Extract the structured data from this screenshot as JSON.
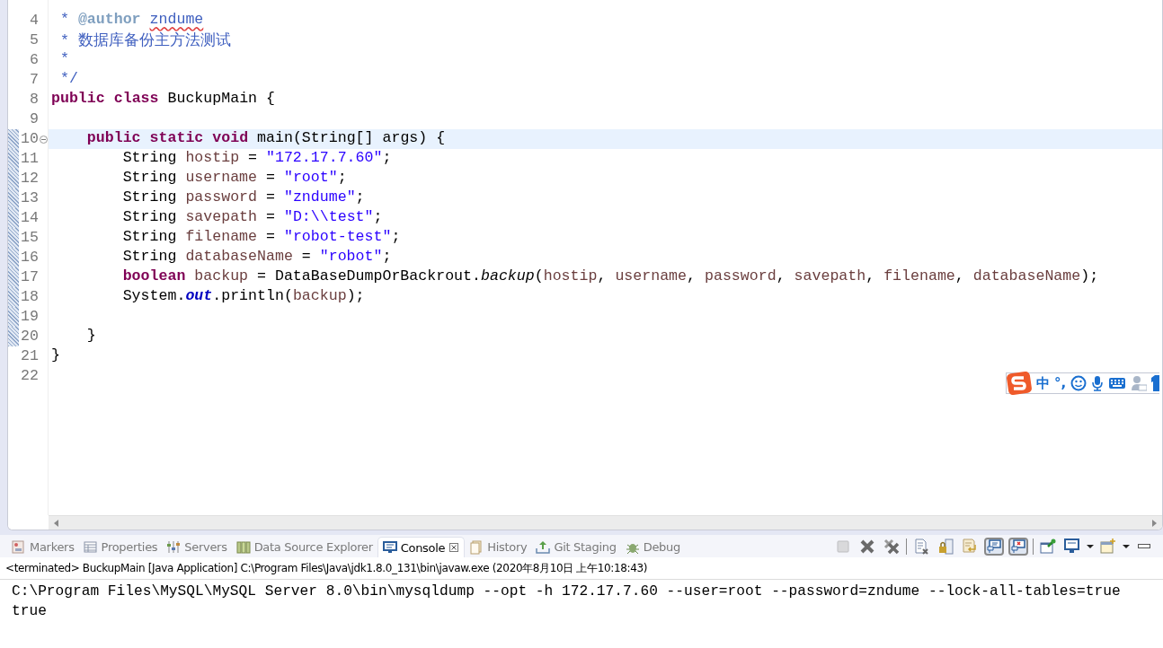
{
  "editor": {
    "lines": [
      {
        "number": "4",
        "current": false,
        "changed": false,
        "tokens": [
          {
            "kind": "comment",
            "text": " * "
          },
          {
            "kind": "doctag",
            "text": "@author "
          },
          {
            "kind": "misspelled",
            "text": "zndume"
          }
        ]
      },
      {
        "number": "5",
        "current": false,
        "changed": false,
        "tokens": [
          {
            "kind": "comment",
            "text": " * 数据库备份主方法测试"
          }
        ]
      },
      {
        "number": "6",
        "current": false,
        "changed": false,
        "tokens": [
          {
            "kind": "comment",
            "text": " *"
          }
        ]
      },
      {
        "number": "7",
        "current": false,
        "changed": false,
        "tokens": [
          {
            "kind": "comment",
            "text": " */"
          }
        ]
      },
      {
        "number": "8",
        "current": false,
        "changed": false,
        "tokens": [
          {
            "kind": "keyword",
            "text": "public "
          },
          {
            "kind": "keyword",
            "text": "class "
          },
          {
            "kind": "plain",
            "text": "BuckupMain {"
          }
        ]
      },
      {
        "number": "9",
        "current": false,
        "changed": false
      },
      {
        "number": "10",
        "current": true,
        "changed": true,
        "fold": {
          "expanded": true
        },
        "tokens": [
          {
            "kind": "keyword",
            "text": "    public "
          },
          {
            "kind": "keyword",
            "text": "static "
          },
          {
            "kind": "keyword",
            "text": "void "
          },
          {
            "kind": "plain",
            "text": "main(String[] args) {"
          }
        ]
      },
      {
        "number": "11",
        "current": false,
        "changed": true,
        "tokens": [
          {
            "kind": "plain",
            "text": "        String "
          },
          {
            "kind": "local",
            "text": "hostip"
          },
          {
            "kind": "plain",
            "text": " = "
          },
          {
            "kind": "string",
            "text": "\"172.17.7.60\""
          },
          {
            "kind": "plain",
            "text": ";"
          }
        ]
      },
      {
        "number": "12",
        "current": false,
        "changed": true,
        "tokens": [
          {
            "kind": "plain",
            "text": "        String "
          },
          {
            "kind": "local",
            "text": "username"
          },
          {
            "kind": "plain",
            "text": " = "
          },
          {
            "kind": "string",
            "text": "\"root\""
          },
          {
            "kind": "plain",
            "text": ";"
          }
        ]
      },
      {
        "number": "13",
        "current": false,
        "changed": true,
        "tokens": [
          {
            "kind": "plain",
            "text": "        String "
          },
          {
            "kind": "local",
            "text": "password"
          },
          {
            "kind": "plain",
            "text": " = "
          },
          {
            "kind": "string",
            "text": "\"zndume\""
          },
          {
            "kind": "plain",
            "text": ";"
          }
        ]
      },
      {
        "number": "14",
        "current": false,
        "changed": true,
        "tokens": [
          {
            "kind": "plain",
            "text": "        String "
          },
          {
            "kind": "local",
            "text": "savepath"
          },
          {
            "kind": "plain",
            "text": " = "
          },
          {
            "kind": "string",
            "text": "\"D:\\\\test\""
          },
          {
            "kind": "plain",
            "text": ";"
          }
        ]
      },
      {
        "number": "15",
        "current": false,
        "changed": true,
        "tokens": [
          {
            "kind": "plain",
            "text": "        String "
          },
          {
            "kind": "local",
            "text": "filename"
          },
          {
            "kind": "plain",
            "text": " = "
          },
          {
            "kind": "string",
            "text": "\"robot-test\""
          },
          {
            "kind": "plain",
            "text": ";"
          }
        ]
      },
      {
        "number": "16",
        "current": false,
        "changed": true,
        "tokens": [
          {
            "kind": "plain",
            "text": "        String "
          },
          {
            "kind": "local",
            "text": "databaseName"
          },
          {
            "kind": "plain",
            "text": " = "
          },
          {
            "kind": "string",
            "text": "\"robot\""
          },
          {
            "kind": "plain",
            "text": ";"
          }
        ]
      },
      {
        "number": "17",
        "current": false,
        "changed": true,
        "tokens": [
          {
            "kind": "keyword",
            "text": "        boolean "
          },
          {
            "kind": "local",
            "text": "backup"
          },
          {
            "kind": "plain",
            "text": " = DataBaseDumpOrBackrout."
          },
          {
            "kind": "static",
            "text": "backup"
          },
          {
            "kind": "plain",
            "text": "("
          },
          {
            "kind": "local",
            "text": "hostip"
          },
          {
            "kind": "plain",
            "text": ", "
          },
          {
            "kind": "local",
            "text": "username"
          },
          {
            "kind": "plain",
            "text": ", "
          },
          {
            "kind": "local",
            "text": "password"
          },
          {
            "kind": "plain",
            "text": ", "
          },
          {
            "kind": "local",
            "text": "savepath"
          },
          {
            "kind": "plain",
            "text": ", "
          },
          {
            "kind": "local",
            "text": "filename"
          },
          {
            "kind": "plain",
            "text": ", "
          },
          {
            "kind": "local",
            "text": "databaseName"
          },
          {
            "kind": "plain",
            "text": ");"
          }
        ]
      },
      {
        "number": "18",
        "current": false,
        "changed": true,
        "tokens": [
          {
            "kind": "plain",
            "text": "        System."
          },
          {
            "kind": "field",
            "text": "out"
          },
          {
            "kind": "plain",
            "text": ".println("
          },
          {
            "kind": "local",
            "text": "backup"
          },
          {
            "kind": "plain",
            "text": ");"
          }
        ]
      },
      {
        "number": "19",
        "current": false,
        "changed": true
      },
      {
        "number": "20",
        "current": false,
        "changed": true,
        "tokens": [
          {
            "kind": "plain",
            "text": "    }"
          }
        ]
      },
      {
        "number": "21",
        "current": false,
        "changed": false,
        "tokens": [
          {
            "kind": "plain",
            "text": "}"
          }
        ]
      },
      {
        "number": "22",
        "current": false,
        "changed": false
      }
    ]
  },
  "ime_toolbar": {
    "items": [
      {
        "kind": "logo"
      },
      {
        "kind": "text",
        "text": "中"
      },
      {
        "kind": "text",
        "text": "°,"
      },
      {
        "kind": "smiley"
      },
      {
        "kind": "mic"
      },
      {
        "kind": "keyboard"
      },
      {
        "kind": "user"
      },
      {
        "kind": "shirt"
      }
    ]
  },
  "panel": {
    "tabs": [
      {
        "label": "Markers",
        "selected": false,
        "kind": "markers"
      },
      {
        "label": "Properties",
        "selected": false,
        "kind": "properties"
      },
      {
        "label": "Servers",
        "selected": false,
        "kind": "servers"
      },
      {
        "label": "Data Source Explorer",
        "selected": false,
        "kind": "datasource"
      },
      {
        "label": "Console",
        "selected": true,
        "kind": "console"
      },
      {
        "label": "History",
        "selected": false,
        "kind": "history"
      },
      {
        "label": "Git Staging",
        "selected": false,
        "kind": "git"
      },
      {
        "label": "Debug",
        "selected": false,
        "kind": "debug"
      }
    ],
    "toolbar": [
      {
        "kind": "stop",
        "disabled": true,
        "pressed": false
      },
      {
        "kind": "remove",
        "disabled": false,
        "pressed": false
      },
      {
        "kind": "remove-all",
        "disabled": false,
        "pressed": false
      },
      {
        "kind": "sep"
      },
      {
        "kind": "clear",
        "disabled": false,
        "pressed": false
      },
      {
        "kind": "lock",
        "disabled": false,
        "pressed": false
      },
      {
        "kind": "wrap",
        "disabled": false,
        "pressed": false
      },
      {
        "kind": "stdout",
        "disabled": false,
        "pressed": true
      },
      {
        "kind": "stderr",
        "disabled": false,
        "pressed": true
      },
      {
        "kind": "sep"
      },
      {
        "kind": "pin",
        "disabled": false,
        "pressed": false
      },
      {
        "kind": "display",
        "disabled": false,
        "pressed": false
      },
      {
        "kind": "dropdown"
      },
      {
        "kind": "new-console",
        "disabled": false,
        "pressed": false
      },
      {
        "kind": "dropdown"
      },
      {
        "kind": "minimize",
        "disabled": false,
        "pressed": false
      }
    ],
    "header": "<terminated> BuckupMain [Java Application] C:\\Program Files\\Java\\jdk1.8.0_131\\bin\\javaw.exe (2020年8月10日 上午10:18:43)",
    "output": [
      "C:\\Program Files\\MySQL\\MySQL Server 8.0\\bin\\mysqldump --opt -h 172.17.7.60 --user=root --password=zndume --lock-all-tables=true",
      "true"
    ]
  }
}
